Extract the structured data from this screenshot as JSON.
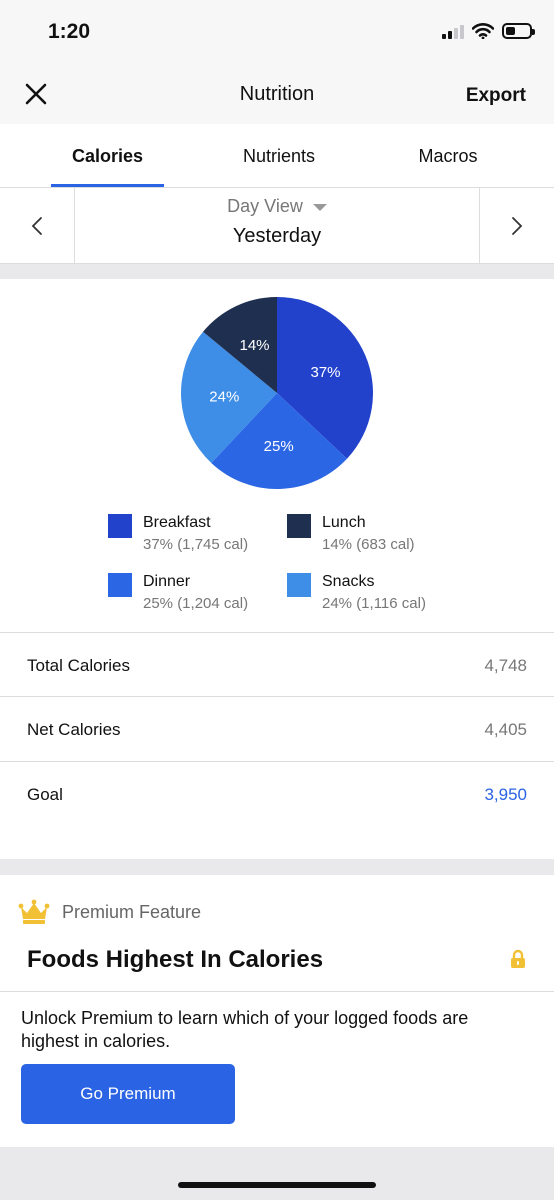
{
  "status": {
    "time": "1:20"
  },
  "nav": {
    "title": "Nutrition",
    "export_label": "Export"
  },
  "tabs": [
    {
      "label": "Calories",
      "active": true
    },
    {
      "label": "Nutrients",
      "active": false
    },
    {
      "label": "Macros",
      "active": false
    }
  ],
  "day": {
    "view_label": "Day View",
    "value": "Yesterday"
  },
  "chart_data": {
    "type": "pie",
    "slices": [
      {
        "name": "Breakfast",
        "percent": 37,
        "calories": "1,745 cal",
        "label": "37%",
        "color": "#2342cc"
      },
      {
        "name": "Dinner",
        "percent": 25,
        "calories": "1,204 cal",
        "label": "25%",
        "color": "#2b66e4"
      },
      {
        "name": "Snacks",
        "percent": 24,
        "calories": "1,116 cal",
        "label": "24%",
        "color": "#3e8ee8"
      },
      {
        "name": "Lunch",
        "percent": 14,
        "calories": "683 cal",
        "label": "14%",
        "color": "#1f2f4f"
      }
    ]
  },
  "legend": [
    {
      "name": "Breakfast",
      "detail": "37% (1,745 cal)",
      "color": "#2342cc"
    },
    {
      "name": "Lunch",
      "detail": "14% (683 cal)",
      "color": "#1f2f4f"
    },
    {
      "name": "Dinner",
      "detail": "25% (1,204 cal)",
      "color": "#2b66e4"
    },
    {
      "name": "Snacks",
      "detail": "24% (1,116 cal)",
      "color": "#3e8ee8"
    }
  ],
  "summary": {
    "total_label": "Total Calories",
    "total_value": "4,748",
    "net_label": "Net Calories",
    "net_value": "4,405",
    "goal_label": "Goal",
    "goal_value": "3,950"
  },
  "premium": {
    "tag": "Premium Feature",
    "title": "Foods Highest In Calories",
    "description": "Unlock Premium to learn which of your logged foods are highest in calories.",
    "button_label": "Go Premium"
  },
  "colors": {
    "accent": "#2a63e3",
    "crown": "#f2c034",
    "lock": "#f2c034"
  }
}
